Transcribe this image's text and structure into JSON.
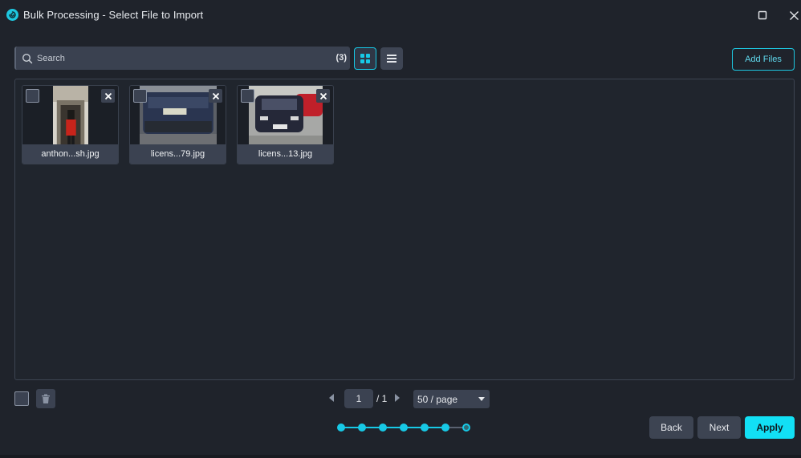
{
  "window": {
    "title": "Bulk Processing - Select File to Import",
    "maximize_icon": "square-icon",
    "close_icon": "x-icon"
  },
  "toolbar": {
    "search_placeholder": "Search",
    "count": "(3)",
    "view_grid_active": true,
    "add_files_label": "Add Files"
  },
  "files": [
    {
      "name": "anthon...sh.jpg"
    },
    {
      "name": "licens...79.jpg"
    },
    {
      "name": "licens...13.jpg"
    }
  ],
  "pagination": {
    "current_page": "1",
    "total_text": "/ 1",
    "page_size": "50 / page"
  },
  "stepper": {
    "total_steps": 7,
    "current_step": 7
  },
  "footer": {
    "back_label": "Back",
    "next_label": "Next",
    "apply_label": "Apply"
  },
  "colors": {
    "accent": "#12e0f5",
    "background": "#1f232b",
    "control": "#3b4251"
  }
}
